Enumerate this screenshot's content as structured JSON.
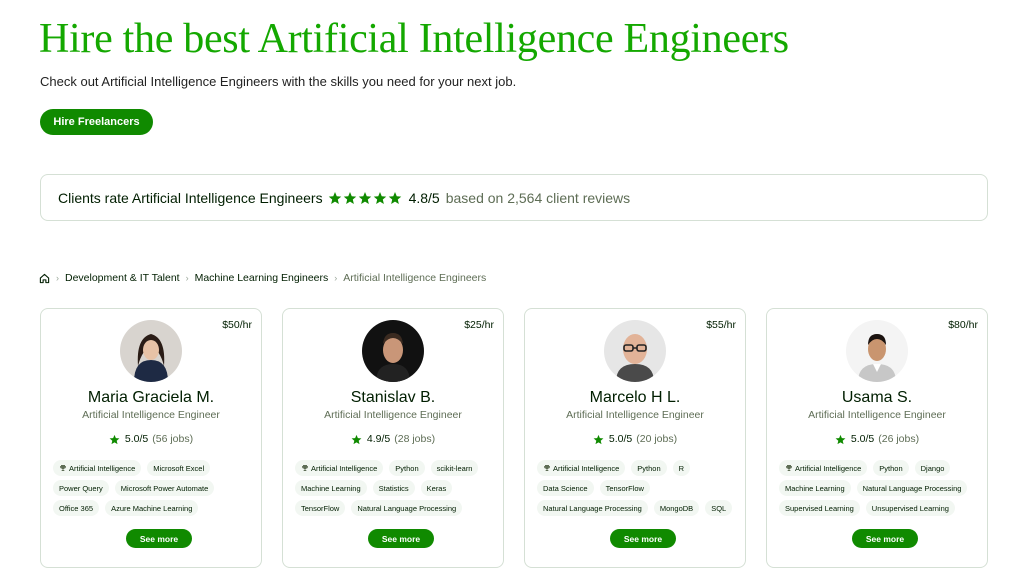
{
  "header": {
    "title": "Hire the best Artificial Intelligence Engineers",
    "subtitle": "Check out Artificial Intelligence Engineers with the skills you need for your next job.",
    "hire_button": "Hire Freelancers"
  },
  "rating": {
    "label": "Clients rate Artificial Intelligence Engineers",
    "stars": 5,
    "score": "4.8/5",
    "based_on": "based on 2,564 client reviews"
  },
  "breadcrumb": {
    "home_icon": "home-icon",
    "items": [
      "Development & IT Talent",
      "Machine Learning Engineers"
    ],
    "current": "Artificial Intelligence Engineers"
  },
  "colors": {
    "brand_green": "#14a800",
    "button_green": "#108a00",
    "tag_bg": "#f2f7f2",
    "border": "#d5e0d5"
  },
  "cards": [
    {
      "rate": "$50/hr",
      "name": "Maria Graciela M.",
      "role": "Artificial Intelligence Engineer",
      "score": "5.0/5",
      "jobs": "(56 jobs)",
      "skills": [
        "Artificial Intelligence",
        "Microsoft Excel",
        "Power Query",
        "Microsoft Power Automate",
        "Office 365",
        "Azure Machine Learning"
      ],
      "see_more": "See more"
    },
    {
      "rate": "$25/hr",
      "name": "Stanislav B.",
      "role": "Artificial Intelligence Engineer",
      "score": "4.9/5",
      "jobs": "(28 jobs)",
      "skills": [
        "Artificial Intelligence",
        "Python",
        "scikit-learn",
        "Machine Learning",
        "Statistics",
        "Keras",
        "TensorFlow",
        "Natural Language Processing"
      ],
      "see_more": "See more"
    },
    {
      "rate": "$55/hr",
      "name": "Marcelo H L.",
      "role": "Artificial Intelligence Engineer",
      "score": "5.0/5",
      "jobs": "(20 jobs)",
      "skills": [
        "Artificial Intelligence",
        "Python",
        "R",
        "Data Science",
        "TensorFlow",
        "Natural Language Processing",
        "MongoDB",
        "SQL"
      ],
      "see_more": "See more"
    },
    {
      "rate": "$80/hr",
      "name": "Usama S.",
      "role": "Artificial Intelligence Engineer",
      "score": "5.0/5",
      "jobs": "(26 jobs)",
      "skills": [
        "Artificial Intelligence",
        "Python",
        "Django",
        "Machine Learning",
        "Natural Language Processing",
        "Supervised Learning",
        "Unsupervised Learning"
      ],
      "see_more": "See more"
    }
  ]
}
